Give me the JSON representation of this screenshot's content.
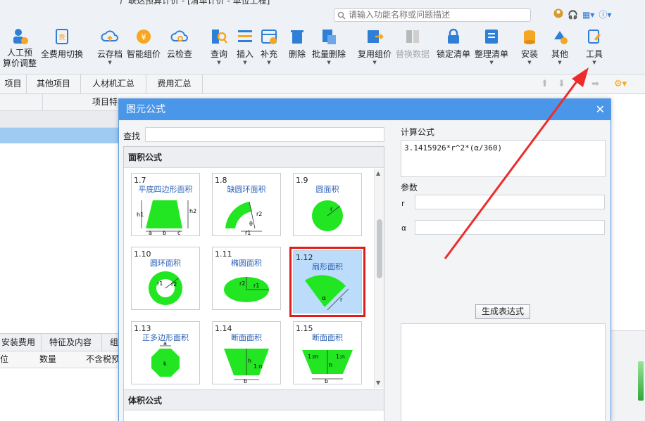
{
  "title_text": "广联达预算计价 - [清单计价 - 单位工程]",
  "search": {
    "placeholder": "请输入功能名称或问题描述"
  },
  "ribbon": {
    "items": [
      {
        "label": "人工预\n算价调整",
        "icon": "person-price-icon"
      },
      {
        "label": "全费用切换",
        "icon": "switch-cost-icon"
      },
      {
        "label": "云存档",
        "icon": "cloud-upload-icon"
      },
      {
        "label": "智能组价",
        "icon": "smart-price-icon"
      },
      {
        "label": "云检查",
        "icon": "cloud-check-icon"
      },
      {
        "label": "查询",
        "icon": "query-icon"
      },
      {
        "label": "插入",
        "icon": "insert-icon"
      },
      {
        "label": "补充",
        "icon": "supplement-icon"
      },
      {
        "label": "删除",
        "icon": "trash-icon"
      },
      {
        "label": "批量删除",
        "icon": "batch-delete-icon"
      },
      {
        "label": "复用组价",
        "icon": "reuse-price-icon"
      },
      {
        "label": "替换数据",
        "icon": "replace-data-icon"
      },
      {
        "label": "锁定清单",
        "icon": "lock-icon"
      },
      {
        "label": "整理清单",
        "icon": "organize-list-icon"
      },
      {
        "label": "安装",
        "icon": "install-icon"
      },
      {
        "label": "其他",
        "icon": "other-icon"
      },
      {
        "label": "工具",
        "icon": "tools-icon"
      }
    ]
  },
  "tabs": [
    "项目",
    "其他项目",
    "人材机汇总",
    "费用汇总"
  ],
  "grid": {
    "col_header": "项目特"
  },
  "bottom_tabs": [
    "安装费用",
    "特征及内容",
    "组"
  ],
  "bottom_head": [
    "位",
    "数量",
    "不含税预"
  ],
  "dialog": {
    "title": "图元公式",
    "find_label": "查找",
    "section_area": "面积公式",
    "section_volume": "体积公式",
    "calc_label": "计算公式",
    "formula": "3.1415926*r^2*(α/360)",
    "params_label": "参数",
    "params": [
      {
        "name": "r"
      },
      {
        "name": "α"
      }
    ],
    "generate_button": "生成表达式",
    "cards": [
      {
        "num": "1.7",
        "title": "平底四边形面积",
        "labels": [
          "h1",
          "a",
          "b",
          "c",
          "h2"
        ]
      },
      {
        "num": "1.8",
        "title": "缺圆环面积",
        "labels": [
          "r2",
          "θ",
          "r1"
        ]
      },
      {
        "num": "1.9",
        "title": "圆面积",
        "labels": [
          "r"
        ]
      },
      {
        "num": "1.10",
        "title": "圆环面积",
        "labels": [
          "r1",
          "r2"
        ]
      },
      {
        "num": "1.11",
        "title": "椭圆面积",
        "labels": [
          "r2",
          "r1"
        ]
      },
      {
        "num": "1.12",
        "title": "扇形面积",
        "labels": [
          "α",
          "r"
        ]
      },
      {
        "num": "1.13",
        "title": "正多边形面积",
        "labels": [
          "a",
          "k"
        ]
      },
      {
        "num": "1.14",
        "title": "断面面积",
        "labels": [
          "h",
          "1:n",
          "b"
        ]
      },
      {
        "num": "1.15",
        "title": "断面面积",
        "labels": [
          "1:m",
          "1:n",
          "h",
          "b"
        ]
      }
    ],
    "selected_card": "1.12"
  },
  "colors": {
    "accent": "#4a96e8",
    "highlight": "#e01d1d",
    "shape_fill": "#22e622",
    "selected_bg": "#bcdcfb"
  }
}
